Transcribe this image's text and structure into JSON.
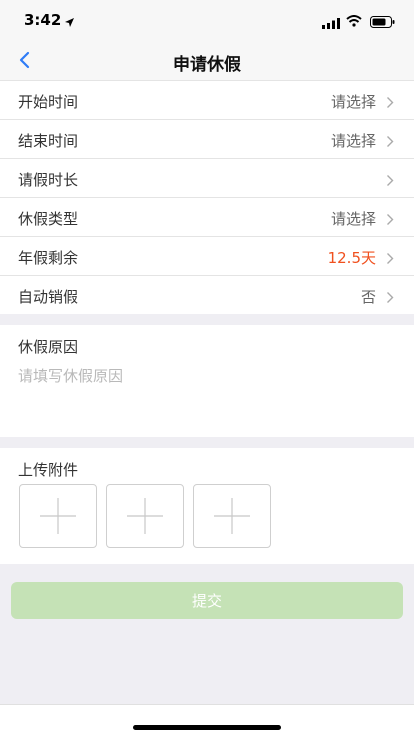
{
  "status_bar": {
    "time": "3:42"
  },
  "nav": {
    "title": "申请休假"
  },
  "form": {
    "rows": [
      {
        "label": "开始时间",
        "value": "请选择"
      },
      {
        "label": "结束时间",
        "value": "请选择"
      },
      {
        "label": "请假时长",
        "value": ""
      },
      {
        "label": "休假类型",
        "value": "请选择"
      },
      {
        "label": "年假剩余",
        "value": "12.5天"
      },
      {
        "label": "自动销假",
        "value": "否"
      }
    ]
  },
  "reason": {
    "title": "休假原因",
    "placeholder": "请填写休假原因"
  },
  "upload": {
    "title": "上传附件"
  },
  "submit": {
    "label": "提交"
  },
  "colors": {
    "accent_orange": "#f0501e",
    "submit_disabled": "#c5e2b6",
    "back_blue": "#2f7cf6"
  }
}
